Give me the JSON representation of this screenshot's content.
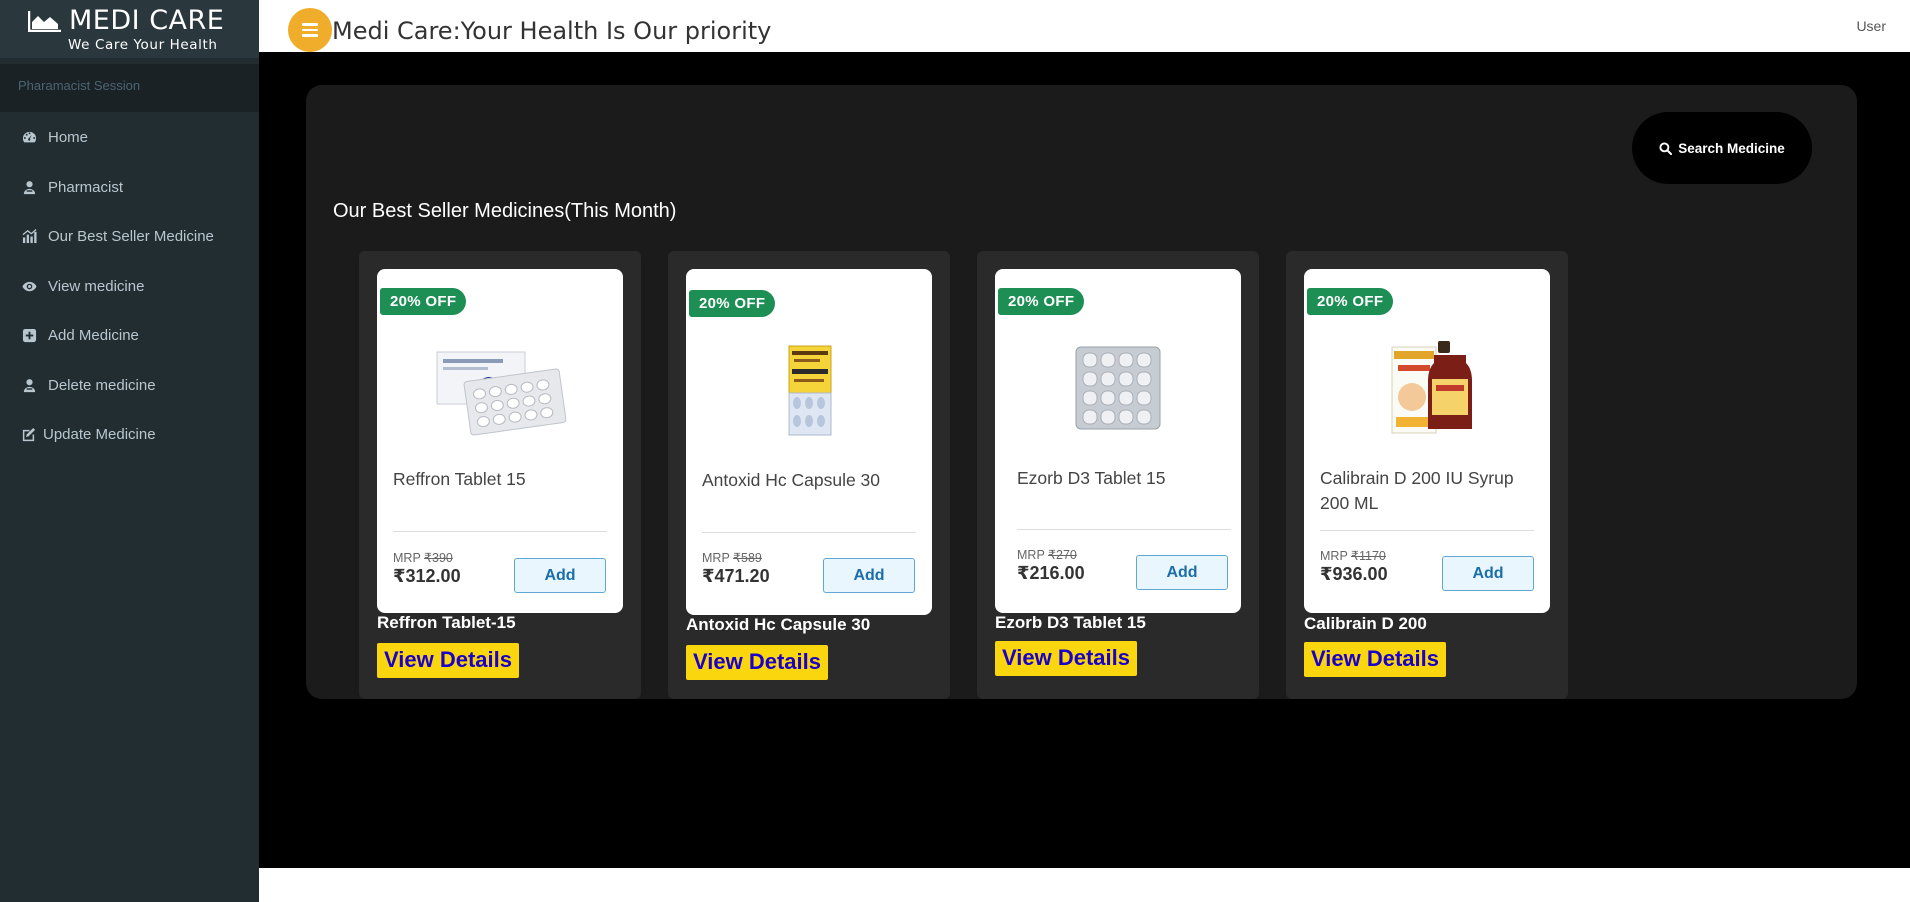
{
  "brand": {
    "title": "MEDI CARE",
    "tagline": "We Care Your Health"
  },
  "sidebar": {
    "session_label": "Pharamacist Session",
    "items": [
      {
        "label": "Home",
        "icon": "dashboard-icon"
      },
      {
        "label": "Pharmacist",
        "icon": "user-doctor-icon"
      },
      {
        "label": "Our Best Seller Medicine",
        "icon": "chart-icon"
      },
      {
        "label": "View medicine",
        "icon": "eye-icon"
      },
      {
        "label": "Add Medicine",
        "icon": "plus-square-icon"
      },
      {
        "label": "Delete medicine",
        "icon": "user-doctor-icon"
      },
      {
        "label": "Update Medicine",
        "icon": "edit-icon"
      }
    ]
  },
  "header": {
    "title": "Medi Care:Your Health Is Our priority",
    "user_label": "User"
  },
  "main": {
    "search_label": "Search Medicine",
    "section_title": "Our Best Seller Medicines(This Month)",
    "add_label": "Add",
    "details_label": "View Details",
    "mrp_label": "MRP",
    "products": [
      {
        "badge": "20% OFF",
        "name": "Reffron Tablet 15",
        "mrp": "₹390",
        "price": "₹312.00",
        "caption": "Reffron Tablet-15"
      },
      {
        "badge": "20% OFF",
        "name": "Antoxid Hc Capsule 30",
        "mrp": "₹589",
        "price": "₹471.20",
        "caption": "Antoxid Hc Capsule 30"
      },
      {
        "badge": "20% OFF",
        "name": "Ezorb D3 Tablet 15",
        "mrp": "₹270",
        "price": "₹216.00",
        "caption": "Ezorb D3 Tablet 15"
      },
      {
        "badge": "20% OFF",
        "name": "Calibrain D 200 IU Syrup 200 ML",
        "mrp": "₹1170",
        "price": "₹936.00",
        "caption": "Calibrain D 200"
      }
    ]
  },
  "colors": {
    "sidebar": "#222d32",
    "accent": "#f0ad2c",
    "badge": "#1d8f55",
    "details_bg": "#f9d60d",
    "details_text": "#1a00c8"
  }
}
